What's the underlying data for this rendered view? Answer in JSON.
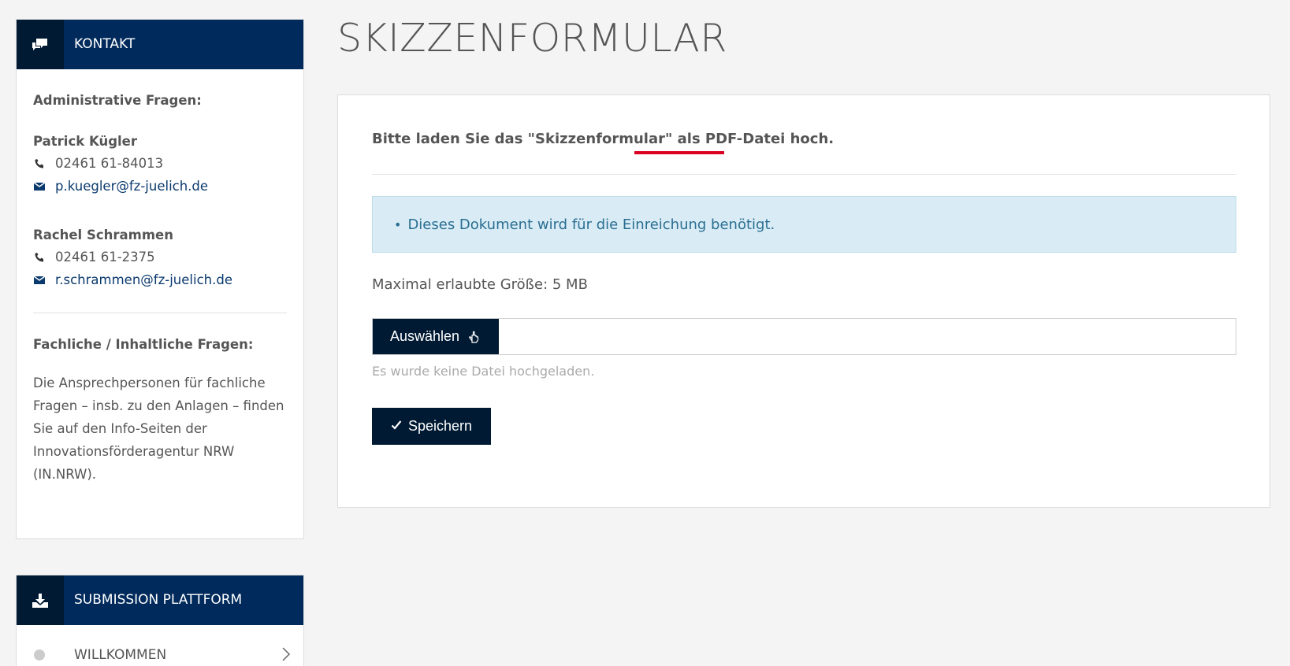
{
  "contact": {
    "title": "KONTAKT",
    "admin_heading": "Administrative Fragen:",
    "persons": [
      {
        "name": "Patrick Kügler",
        "phone": "02461 61-84013",
        "email": "p.kuegler@fz-juelich.de"
      },
      {
        "name": "Rachel Schrammen",
        "phone": "02461 61-2375",
        "email": "r.schrammen@fz-juelich.de"
      }
    ],
    "tech_heading": "Fachliche / Inhaltliche Fragen:",
    "tech_text": "Die Ansprechpersonen für fachliche Fragen – insb. zu den Anlagen – finden Sie auf den Info-Seiten der Innovationsförderagentur NRW (IN.NRW)."
  },
  "submission": {
    "title": "SUBMISSION PLATTFORM",
    "items": [
      {
        "label": "WILLKOMMEN"
      }
    ]
  },
  "main": {
    "title": "SKIZZENFORMULAR",
    "intro": "Bitte laden Sie das \"Skizzenformular\" als PDF-Datei hoch.",
    "info": "Dieses Dokument wird für die Einreichung benötigt.",
    "max_size": "Maximal erlaubte Größe: 5 MB",
    "choose_label": "Auswählen",
    "no_file": "Es wurde keine Datei hochgeladen.",
    "save_label": "Speichern"
  },
  "colors": {
    "navy": "#002a5c",
    "dark": "#001a33",
    "info_bg": "#d9ecf5",
    "info_text": "#2a6e92",
    "red_underline": "#d90022"
  }
}
